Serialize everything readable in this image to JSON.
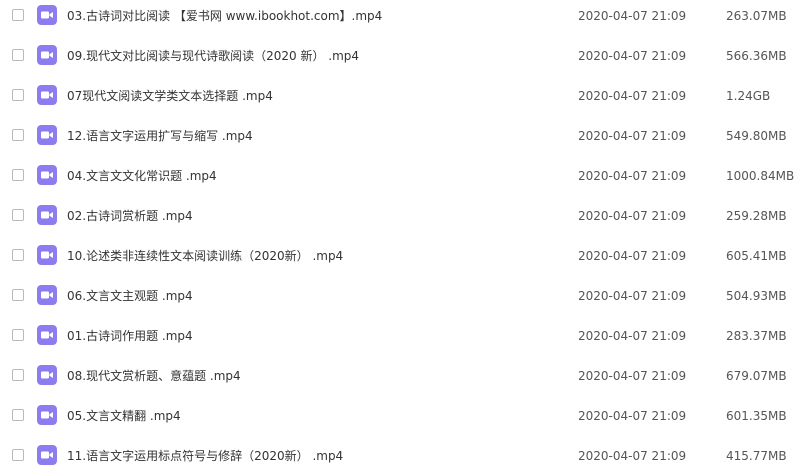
{
  "icon_color": "#8c7cf0",
  "icon_name": "video-file-icon",
  "files": [
    {
      "name": "03.古诗词对比阅读 【爱书网 www.ibookhot.com】.mp4",
      "date": "2020-04-07 21:09",
      "size": "263.07MB"
    },
    {
      "name": "09.现代文对比阅读与现代诗歌阅读（2020 新） .mp4",
      "date": "2020-04-07 21:09",
      "size": "566.36MB"
    },
    {
      "name": "07现代文阅读文学类文本选择题 .mp4",
      "date": "2020-04-07 21:09",
      "size": "1.24GB"
    },
    {
      "name": "12.语言文字运用扩写与缩写 .mp4",
      "date": "2020-04-07 21:09",
      "size": "549.80MB"
    },
    {
      "name": "04.文言文文化常识题 .mp4",
      "date": "2020-04-07 21:09",
      "size": "1000.84MB"
    },
    {
      "name": "02.古诗词赏析题 .mp4",
      "date": "2020-04-07 21:09",
      "size": "259.28MB"
    },
    {
      "name": "10.论述类非连续性文本阅读训练（2020新） .mp4",
      "date": "2020-04-07 21:09",
      "size": "605.41MB"
    },
    {
      "name": "06.文言文主观题 .mp4",
      "date": "2020-04-07 21:09",
      "size": "504.93MB"
    },
    {
      "name": "01.古诗词作用题 .mp4",
      "date": "2020-04-07 21:09",
      "size": "283.37MB"
    },
    {
      "name": "08.现代文赏析题、意蕴题 .mp4",
      "date": "2020-04-07 21:09",
      "size": "679.07MB"
    },
    {
      "name": "05.文言文精翻 .mp4",
      "date": "2020-04-07 21:09",
      "size": "601.35MB"
    },
    {
      "name": "11.语言文字运用标点符号与修辞（2020新） .mp4",
      "date": "2020-04-07 21:09",
      "size": "415.77MB"
    }
  ]
}
